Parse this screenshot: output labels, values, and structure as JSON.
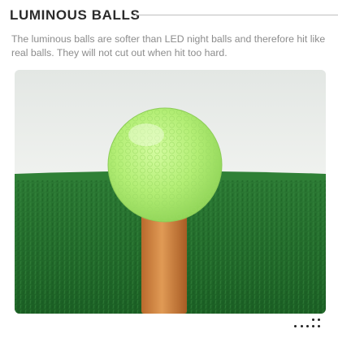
{
  "section": {
    "title": "LUMINOUS BALLS",
    "description": "The luminous balls are softer than LED night balls and therefore hit like real balls. They will not cut out when hit too hard."
  },
  "photo": {
    "subject": "glow golf ball on tee",
    "colors": {
      "ball": "#b6f07a",
      "tee": "#cf7f3e",
      "turf": "#1f6e2a",
      "backdrop": "#e9ece8"
    }
  },
  "pagination": {
    "icon": "dot-grid-icon"
  }
}
